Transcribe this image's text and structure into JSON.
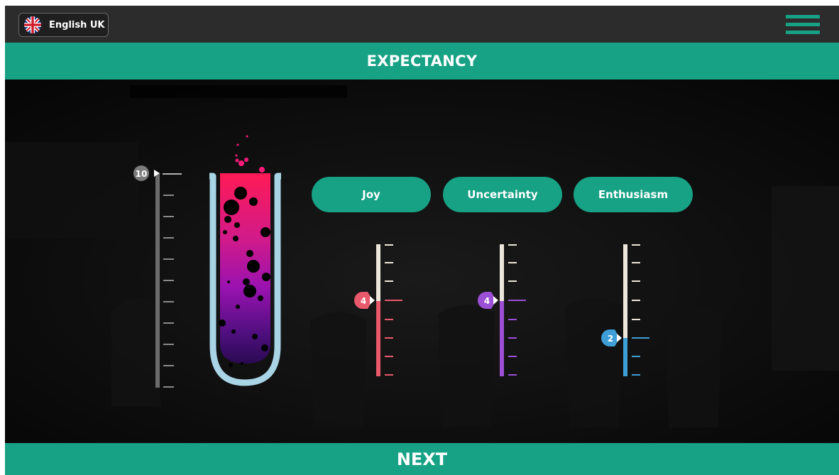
{
  "header": {
    "language_label": "English UK"
  },
  "title_bar": {
    "title": "EXPECTANCY"
  },
  "main_scale": {
    "value": "10"
  },
  "emotions": [
    {
      "label": "Joy",
      "value": "4",
      "color": "#e8596b"
    },
    {
      "label": "Uncertainty",
      "value": "4",
      "color": "#9b4fd6"
    },
    {
      "label": "Enthusiasm",
      "value": "2",
      "color": "#3e9ed6"
    }
  ],
  "footer": {
    "next_label": "NEXT"
  },
  "colors": {
    "accent": "#17a185",
    "tube_outline": "#a8d4e6",
    "liquid_top": "#ff1a55",
    "liquid_bottom": "#2a0a52"
  }
}
